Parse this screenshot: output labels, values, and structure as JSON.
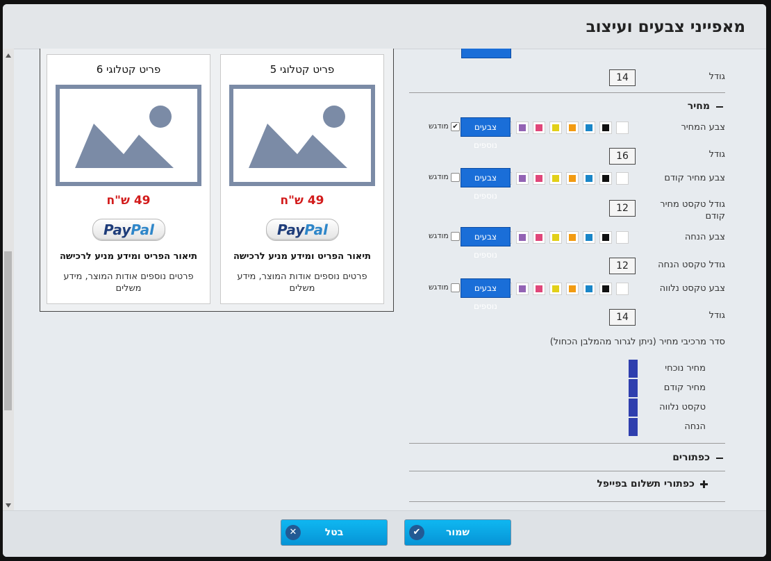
{
  "dialog": {
    "title": "מאפייני צבעים ועיצוב"
  },
  "cards": [
    {
      "title": "פריט קטלוגי 6",
      "price": "49 ש\"ח",
      "paypal_a": "Pay",
      "paypal_b": "Pal",
      "desc": "תיאור הפריט ומידע מניע לרכישה",
      "more": "פרטים נוספים אודות המוצר, מידע משלים"
    },
    {
      "title": "פריט קטלוגי 5",
      "price": "49 ש\"ח",
      "paypal_a": "Pay",
      "paypal_b": "Pal",
      "desc": "תיאור הפריט ומידע מניע לרכישה",
      "more": "פרטים נוספים אודות המוצר, מידע משלים"
    }
  ],
  "settings": {
    "size_label": "גודל",
    "top_size": "14",
    "price_section": "מחיר",
    "more_colors": "צבעים נוספים",
    "bold": "מודגש",
    "price_color": "צבע המחיר",
    "price_size": "16",
    "old_price_color": "צבע מחיר קודם",
    "old_price_text_size_label": "גודל טקסט מחיר קודם",
    "old_price_text_size": "12",
    "discount_color": "צבע הנחה",
    "discount_text_size_label": "גודל טקסט הנחה",
    "discount_text_size": "12",
    "accompany_color": "צבע טקסט נלווה",
    "accompany_size": "14",
    "order_label": "סדר מרכיבי מחיר (ניתן לגרור מהמלבן הכחול)",
    "order_items": [
      "מחיר נוכחי",
      "מחיר קודם",
      "טקסט נלווה",
      "הנחה"
    ],
    "buttons_section": "כפתורים",
    "paypal_buttons": "כפתורי תשלום בפייפל"
  },
  "colors": {
    "palette": [
      "#ffffff",
      "#111111",
      "#1a86c8",
      "#f29b12",
      "#e2d019",
      "#e0477a",
      "#9363b4",
      "#e5131b"
    ],
    "accent": "#1a6ed8"
  },
  "footer": {
    "save": "שמור",
    "cancel": "בטל"
  }
}
